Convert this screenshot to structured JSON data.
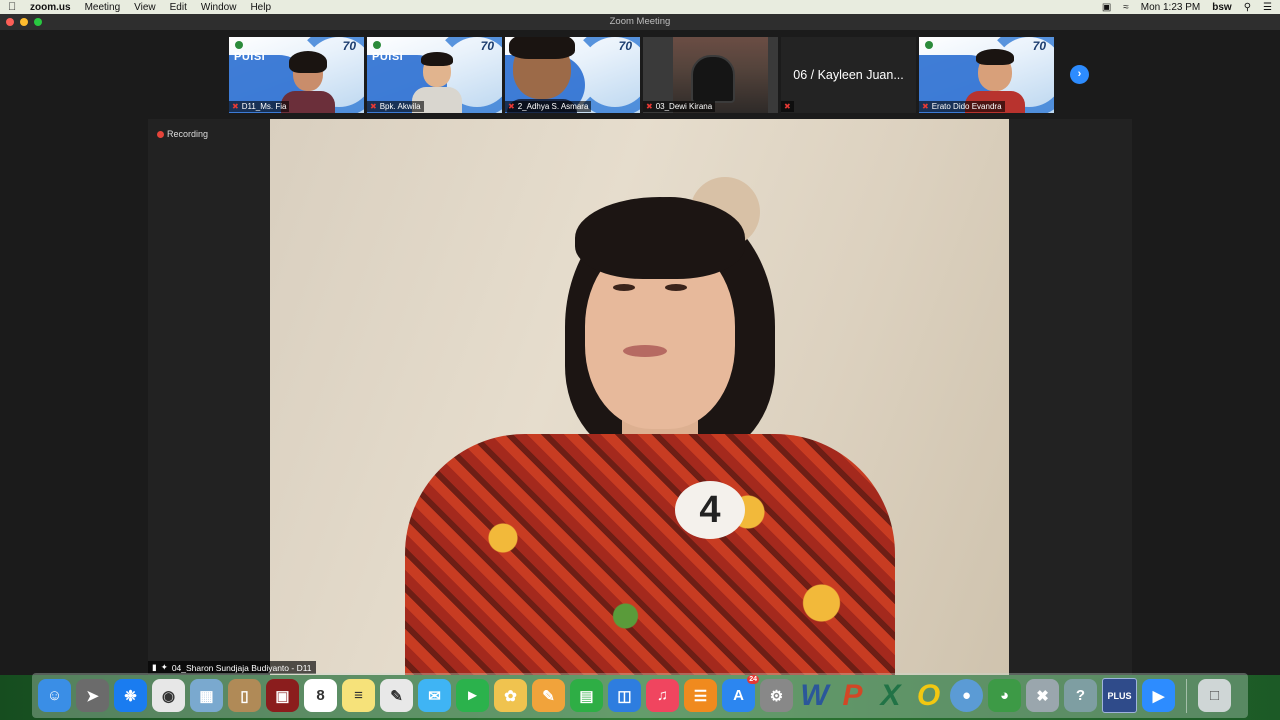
{
  "menubar": {
    "app": "zoom.us",
    "items": [
      "Meeting",
      "View",
      "Edit",
      "Window",
      "Help"
    ],
    "clock": "Mon 1:23 PM",
    "user": "bsw"
  },
  "window": {
    "title": "Zoom Meeting"
  },
  "thumbnails": [
    {
      "name": "D11_Ms. Fia"
    },
    {
      "name": "Bpk. Akwila"
    },
    {
      "name": "2_Adhya S. Asmara"
    },
    {
      "name": "03_Dewi Kirana"
    },
    {
      "name": "06 / Kayleen Juan..."
    },
    {
      "name": "Erato Dido Evandra"
    }
  ],
  "poster": {
    "title": "PUISI",
    "number": "70"
  },
  "main": {
    "recording_label": "Recording",
    "speaker_name": "04_Sharon Sundjaja Budiyanto - D11",
    "badge_number": "4"
  },
  "colors": {
    "accent": "#2d8cff",
    "recording": "#e5443a",
    "muted": "#e53935"
  },
  "dock": {
    "apps": [
      {
        "name": "finder",
        "color": "#3a8ee6"
      },
      {
        "name": "launchpad",
        "color": "#6b6b6b"
      },
      {
        "name": "safari",
        "color": "#1a7cf0"
      },
      {
        "name": "chrome",
        "color": "#e7e7e7"
      },
      {
        "name": "preview",
        "color": "#7aa9cf"
      },
      {
        "name": "contacts",
        "color": "#b08a57"
      },
      {
        "name": "photo-booth",
        "color": "#8b1d1d"
      },
      {
        "name": "calendar",
        "color": "#ffffff"
      },
      {
        "name": "notes",
        "color": "#f6e27a"
      },
      {
        "name": "textedit",
        "color": "#e8e8e8"
      },
      {
        "name": "messages",
        "color": "#3fb4f4"
      },
      {
        "name": "facetime",
        "color": "#2bb24c"
      },
      {
        "name": "photos",
        "color": "#f0c34f"
      },
      {
        "name": "pages",
        "color": "#f1a33b"
      },
      {
        "name": "numbers",
        "color": "#2eae45"
      },
      {
        "name": "keynote",
        "color": "#2e7ddf"
      },
      {
        "name": "music",
        "color": "#f0455f"
      },
      {
        "name": "books",
        "color": "#f08a1e"
      },
      {
        "name": "app-store",
        "color": "#2c86f0"
      },
      {
        "name": "system-preferences",
        "color": "#888888"
      },
      {
        "name": "word",
        "color": "#2b579a"
      },
      {
        "name": "powerpoint",
        "color": "#d24726"
      },
      {
        "name": "excel",
        "color": "#217346"
      },
      {
        "name": "outlook",
        "color": "#f2c811"
      },
      {
        "name": "teams",
        "color": "#5b9bd5"
      },
      {
        "name": "network",
        "color": "#3d9a46"
      },
      {
        "name": "directory-utility",
        "color": "#9aa6ad"
      },
      {
        "name": "help",
        "color": "#7e9ea2"
      },
      {
        "name": "plus",
        "color": "#2f4b8a"
      },
      {
        "name": "zoom",
        "color": "#2d8cff"
      }
    ],
    "calendar_day": "8",
    "app_store_badge": "24",
    "plus_label": "PLUS"
  }
}
